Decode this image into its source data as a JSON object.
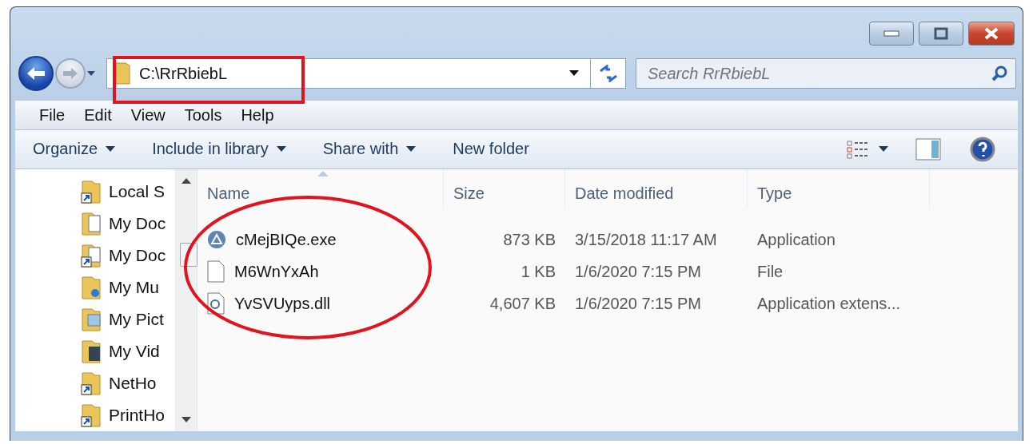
{
  "address": {
    "path": "C:\\RrRbiebL"
  },
  "search": {
    "placeholder": "Search RrRbiebL"
  },
  "menu": [
    "File",
    "Edit",
    "View",
    "Tools",
    "Help"
  ],
  "toolbar": [
    {
      "label": "Organize",
      "dropdown": true
    },
    {
      "label": "Include in library",
      "dropdown": true
    },
    {
      "label": "Share with",
      "dropdown": true
    },
    {
      "label": "New folder",
      "dropdown": false
    }
  ],
  "sidebar": {
    "items": [
      {
        "label": "Local S",
        "kind": "shortcut"
      },
      {
        "label": "My Doc",
        "kind": "documents"
      },
      {
        "label": "My Doc",
        "kind": "docshortcut"
      },
      {
        "label": "My Mu",
        "kind": "music"
      },
      {
        "label": "My Pict",
        "kind": "pictures"
      },
      {
        "label": "My Vid",
        "kind": "videos"
      },
      {
        "label": "NetHo",
        "kind": "shortcut"
      },
      {
        "label": "PrintHo",
        "kind": "shortcut"
      }
    ]
  },
  "table": {
    "columns": [
      {
        "label": "Name",
        "sorted": true
      },
      {
        "label": "Size",
        "sorted": false
      },
      {
        "label": "Date modified",
        "sorted": false
      },
      {
        "label": "Type",
        "sorted": false
      }
    ],
    "rows": [
      {
        "name": "cMejBIQe.exe",
        "kind": "application",
        "size": "873 KB",
        "date": "3/15/2018 11:17 AM",
        "type": "Application"
      },
      {
        "name": "M6WnYxAh",
        "kind": "file",
        "size": "1 KB",
        "date": "1/6/2020 7:15 PM",
        "type": "File"
      },
      {
        "name": "YvSVUyps.dll",
        "kind": "extension",
        "size": "4,607 KB",
        "date": "1/6/2020 7:15 PM",
        "type": "Application extens..."
      }
    ]
  }
}
